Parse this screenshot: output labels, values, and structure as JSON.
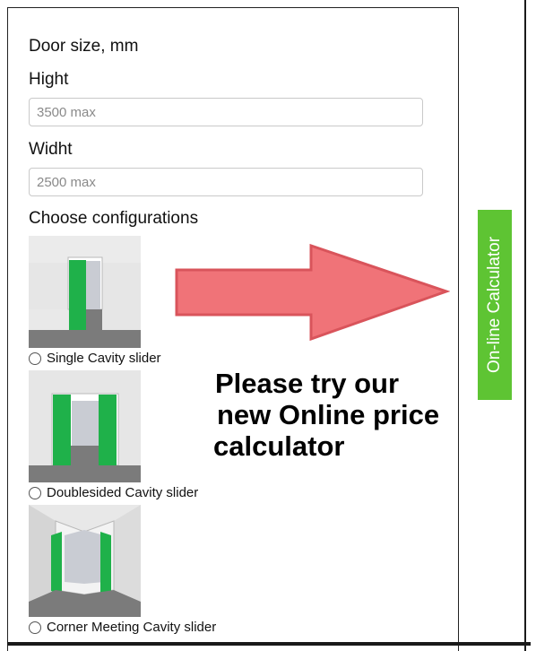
{
  "form": {
    "section_title": "Door size, mm",
    "height_label": "Hight",
    "height_placeholder": "3500 max",
    "width_label": "Widht",
    "width_placeholder": "2500 max",
    "configurations_title": "Choose configurations",
    "options": [
      {
        "label": "Single Cavity slider",
        "selected": false
      },
      {
        "label": "Doublesided Cavity slider",
        "selected": false
      },
      {
        "label": "Corner Meeting Cavity slider",
        "selected": false
      }
    ]
  },
  "promo": {
    "line1": "Please try our",
    "line2": "new Online price",
    "line3": "calculator"
  },
  "calculator_tab": {
    "label": "On-line Calculator",
    "color": "#5ec433"
  },
  "colors": {
    "arrow_fill": "#f07378",
    "arrow_stroke": "#d9545b",
    "door_green": "#1fb14a",
    "floor_gray": "#7b7b7b"
  }
}
